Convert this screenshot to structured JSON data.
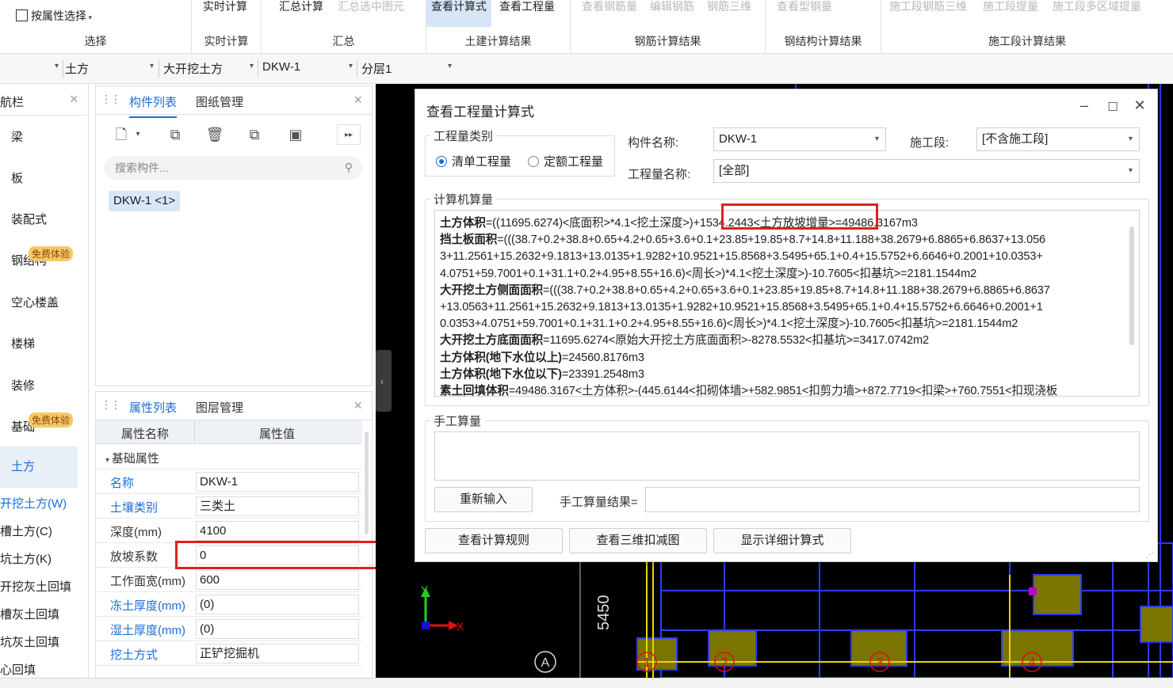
{
  "ribbon": {
    "select_by_attr": "按属性选择",
    "groups": [
      {
        "name": "选择",
        "buttons": []
      },
      {
        "name": "实时计算",
        "buttons": [
          "实时计算"
        ]
      },
      {
        "name": "汇总",
        "buttons": [
          "汇总计算",
          "汇总选中图元"
        ]
      },
      {
        "name": "土建计算结果",
        "buttons": [
          "查看计算式",
          "查看工程量"
        ]
      },
      {
        "name": "钢筋计算结果",
        "buttons": [
          "查看钢筋量",
          "编辑钢筋",
          "钢筋三维"
        ]
      },
      {
        "name": "钢结构计算结果",
        "buttons": [
          "查看型钢量"
        ]
      },
      {
        "name": "施工段计算结果",
        "buttons": [
          "施工段钢筋三维",
          "施工段提量",
          "施工段多区域提量"
        ]
      }
    ]
  },
  "selector_bar": [
    "土方",
    "大开挖土方",
    "DKW-1",
    "分层1"
  ],
  "nav": {
    "title": "航栏",
    "items": [
      "梁",
      "板",
      "装配式",
      "钢结构",
      "空心楼盖",
      "楼梯",
      "装修",
      "基础",
      "土方"
    ],
    "badge": "免费体验",
    "sub_items": [
      "开挖土方(W)",
      "槽土方(C)",
      "坑土方(K)",
      "开挖灰土回填",
      "槽灰土回填",
      "坑灰土回填",
      "心回填"
    ]
  },
  "component_panel": {
    "tabs": [
      "构件列表",
      "图纸管理"
    ],
    "search_placeholder": "搜索构件...",
    "item": "DKW-1 <1>"
  },
  "property_panel": {
    "tabs": [
      "属性列表",
      "图层管理"
    ],
    "headers": [
      "属性名称",
      "属性值"
    ],
    "group": "基础属性",
    "rows": [
      {
        "name": "名称",
        "value": "DKW-1"
      },
      {
        "name": "土壤类别",
        "value": "三类土"
      },
      {
        "name": "深度(mm)",
        "value": "4100"
      },
      {
        "name": "放坡系数",
        "value": "0"
      },
      {
        "name": "工作面宽(mm)",
        "value": "600"
      },
      {
        "name": "冻土厚度(mm)",
        "value": "(0)"
      },
      {
        "name": "湿土厚度(mm)",
        "value": "(0)"
      },
      {
        "name": "挖土方式",
        "value": "正铲挖掘机"
      }
    ]
  },
  "cad": {
    "dimension": "5450",
    "axis_y": "Y",
    "axis_x": "X",
    "axis_labels": [
      "A",
      "1",
      "2",
      "3",
      "4"
    ]
  },
  "dialog": {
    "title": "查看工程量计算式",
    "category_legend": "工程量类别",
    "radio_bill": "清单工程量",
    "radio_quota": "定额工程量",
    "component_name_label": "构件名称:",
    "component_name_value": "DKW-1",
    "section_label": "施工段:",
    "section_value": "[不含施工段]",
    "quantity_name_label": "工程量名称:",
    "quantity_name_value": "[全部]",
    "computer_legend": "计算机算量",
    "calc_lines": [
      {
        "b": "土方体积",
        "t": "=((11695.6274)<底面积>*4.1<挖土深度>)+1534.2443<土方放坡增量>=49486.3167m3"
      },
      {
        "b": "挡土板面积",
        "t": "=(((38.7+0.2+38.8+0.65+4.2+0.65+3.6+0.1+23.85+19.85+8.7+14.8+11.188+38.2679+6.8865+6.8637+13.056"
      },
      {
        "b": "",
        "t": "3+11.2561+15.2632+9.1813+13.0135+1.9282+10.9521+15.8568+3.5495+65.1+0.4+15.5752+6.6646+0.2001+10.0353+"
      },
      {
        "b": "",
        "t": "4.0751+59.7001+0.1+31.1+0.2+4.95+8.55+16.6)<周长>)*4.1<挖土深度>)-10.7605<扣基坑>=2181.1544m2"
      },
      {
        "b": "大开挖土方侧面面积",
        "t": "=(((38.7+0.2+38.8+0.65+4.2+0.65+3.6+0.1+23.85+19.85+8.7+14.8+11.188+38.2679+6.8865+6.8637"
      },
      {
        "b": "",
        "t": "+13.0563+11.2561+15.2632+9.1813+13.0135+1.9282+10.9521+15.8568+3.5495+65.1+0.4+15.5752+6.6646+0.2001+1"
      },
      {
        "b": "",
        "t": "0.0353+4.0751+59.7001+0.1+31.1+0.2+4.95+8.55+16.6)<周长>)*4.1<挖土深度>)-10.7605<扣基坑>=2181.1544m2"
      },
      {
        "b": "大开挖土方底面面积",
        "t": "=11695.6274<原始大开挖土方底面面积>-8278.5532<扣基坑>=3417.0742m2"
      },
      {
        "b": "土方体积(地下水位以上)",
        "t": "=24560.8176m3"
      },
      {
        "b": "土方体积(地下水位以下)",
        "t": "=23391.2548m3"
      },
      {
        "b": "素土回填体积",
        "t": "=49486.3167<土方体积>-(445.6144<扣砌体墙>+582.9851<扣剪力墙>+872.7719<扣梁>+760.7551<扣现浇板"
      }
    ],
    "manual_legend": "手工算量",
    "reenter": "重新输入",
    "manual_result_label": "手工算量结果=",
    "btn_rules": "查看计算规则",
    "btn_3d": "查看三维扣减图",
    "btn_detail": "显示详细计算式"
  },
  "colors": {
    "accent": "#1a6ed8",
    "highlight": "#e02020",
    "cad_bg": "#000000"
  }
}
